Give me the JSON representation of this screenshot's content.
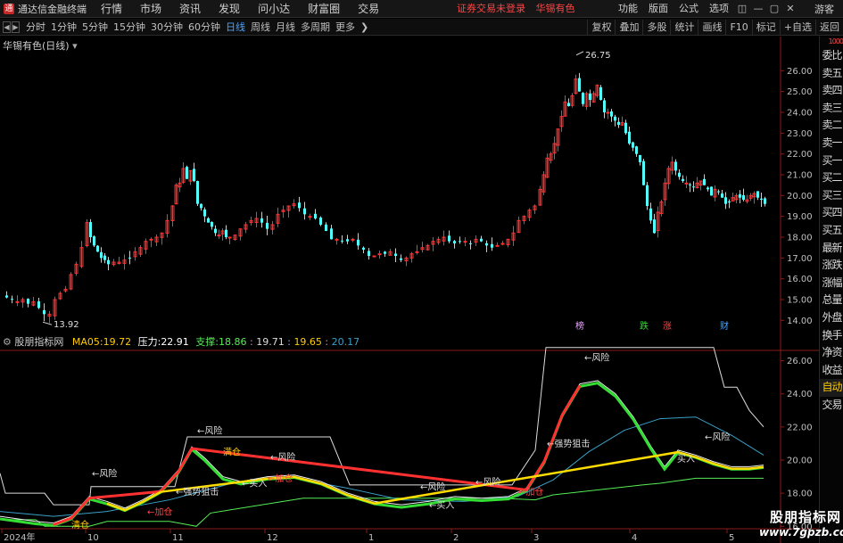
{
  "window": {
    "app_name": "通达信金融终端",
    "menu": [
      "行情",
      "市场",
      "资讯",
      "发现",
      "问小达",
      "财富圈",
      "交易"
    ],
    "notice": [
      "证券交易未登录",
      "华锡有色"
    ],
    "right_menu": [
      "功能",
      "版面",
      "公式",
      "选项"
    ],
    "guest_label": "游客"
  },
  "toolbar": {
    "periods": [
      "分时",
      "1分钟",
      "5分钟",
      "15分钟",
      "30分钟",
      "60分钟",
      "日线",
      "周线",
      "月线",
      "多周期",
      "更多"
    ],
    "active_period": "日线",
    "tools": [
      "复权",
      "叠加",
      "多股",
      "统计",
      "画线",
      "F10",
      "标记",
      "+自选",
      "返回"
    ]
  },
  "main_chart": {
    "title": "华锡有色(日线)",
    "max_label": "26.75",
    "min_label": "13.92",
    "y_ticks": [
      "26.00",
      "25.00",
      "24.00",
      "23.00",
      "22.00",
      "21.00",
      "20.00",
      "19.00",
      "18.00",
      "17.00",
      "16.00",
      "15.00",
      "14.00"
    ],
    "event_marks": [
      {
        "text": "榜",
        "color": "#e8a0ff"
      },
      {
        "text": "跌",
        "color": "#33dd33"
      },
      {
        "text": "涨",
        "color": "#ff4444"
      },
      {
        "text": "财",
        "color": "#4aa3ff"
      }
    ]
  },
  "indicator": {
    "name": "股朋指标网",
    "ma_label": "MA05:",
    "ma_value": "19.72",
    "pressure_label": "压力:",
    "pressure_value": "22.91",
    "support_label": "支撑:",
    "support_values": [
      "18.86",
      "19.71",
      "19.65",
      "20.17"
    ],
    "y_ticks": [
      "26.00",
      "24.00",
      "22.00",
      "20.00",
      "18.00",
      "16.00"
    ],
    "annotations": [
      {
        "text": "←风险",
        "color": "#dddddd"
      },
      {
        "text": "←风险",
        "color": "#dddddd"
      },
      {
        "text": "←风险",
        "color": "#dddddd"
      },
      {
        "text": "←风险",
        "color": "#dddddd"
      },
      {
        "text": "←风险",
        "color": "#dddddd"
      },
      {
        "text": "←风险",
        "color": "#dddddd"
      },
      {
        "text": "←风险",
        "color": "#dddddd"
      },
      {
        "text": "←强势狙击",
        "color": "#dddddd"
      },
      {
        "text": "←强势狙击",
        "color": "#dddddd"
      },
      {
        "text": "←买入",
        "color": "#dddddd"
      },
      {
        "text": "←买入",
        "color": "#dddddd"
      },
      {
        "text": "买入",
        "color": "#dddddd"
      },
      {
        "text": "←加仓",
        "color": "#ff4444"
      },
      {
        "text": "←加仓",
        "color": "#ff4444"
      },
      {
        "text": "←加仓",
        "color": "#ff4444"
      },
      {
        "text": "清仓",
        "color": "#ffcc00"
      },
      {
        "text": "满仓",
        "color": "#ffcc00"
      }
    ]
  },
  "x_axis": [
    "2024年",
    "10",
    "11",
    "12",
    "1",
    "2",
    "3",
    "4",
    "5"
  ],
  "sidebar": {
    "top_label": "1000",
    "tabs": [
      "委比",
      "卖五",
      "卖四",
      "卖三",
      "卖二",
      "卖一",
      "买一",
      "买二",
      "买三",
      "买四",
      "买五",
      "最新",
      "涨跌",
      "涨幅",
      "总量",
      "外盘",
      "换手",
      "净资",
      "收益",
      "自动",
      "交易"
    ]
  },
  "watermark": {
    "line1": "股朋指标网",
    "line2": "www.7gpzb.com"
  },
  "colors": {
    "up": "#ff3030",
    "down": "#54ffff",
    "ma": "#ffcc00",
    "risk_line": "#dddddd",
    "support_line": "#55ee55",
    "slow_line": "#3aa0c8"
  }
}
